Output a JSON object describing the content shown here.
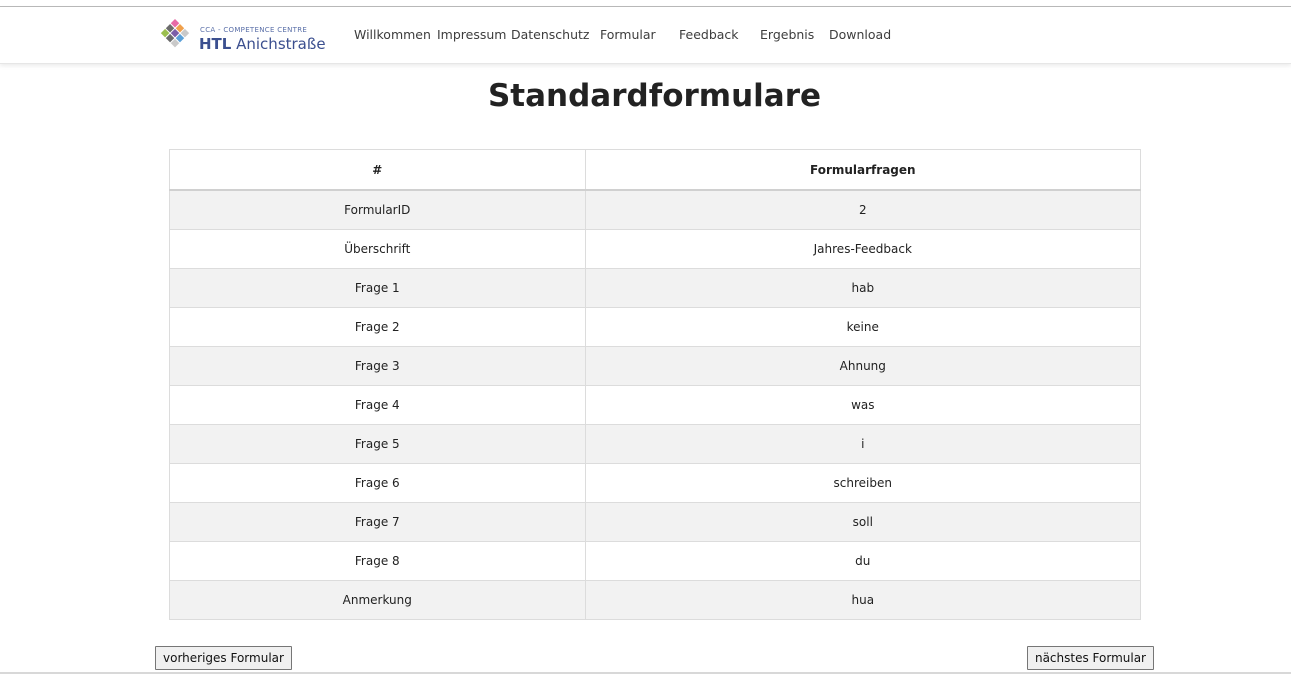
{
  "logo": {
    "subtitle": "CCA - COMPETENCE CENTRE",
    "title_bold": "HTL",
    "title_rest": "Anichstraße"
  },
  "nav": {
    "items": [
      {
        "label": "Willkommen"
      },
      {
        "label": "Impressum"
      },
      {
        "label": "Datenschutz"
      },
      {
        "label": "Formular"
      },
      {
        "label": "Feedback"
      },
      {
        "label": "Ergebnis"
      },
      {
        "label": "Download"
      }
    ]
  },
  "page_title": "Standardformulare",
  "table": {
    "headers": [
      "#",
      "Formularfragen"
    ],
    "rows": [
      [
        "FormularID",
        "2"
      ],
      [
        "Überschrift",
        "Jahres-Feedback"
      ],
      [
        "Frage 1",
        "hab"
      ],
      [
        "Frage 2",
        "keine"
      ],
      [
        "Frage 3",
        "Ahnung"
      ],
      [
        "Frage 4",
        "was"
      ],
      [
        "Frage 5",
        "i"
      ],
      [
        "Frage 6",
        "schreiben"
      ],
      [
        "Frage 7",
        "soll"
      ],
      [
        "Frage 8",
        "du"
      ],
      [
        "Anmerkung",
        "hua"
      ]
    ]
  },
  "buttons": {
    "prev": "vorheriges Formular",
    "next": "nächstes Formular"
  },
  "colors": {
    "logo_diamonds": [
      "#e86aa6",
      "#f0a04b",
      "#7b5ea7",
      "#5aa0d8",
      "#9bbf4e",
      "#6b6b6b",
      "#c9c9c9"
    ],
    "row_stripe": "#f2f2f2"
  }
}
